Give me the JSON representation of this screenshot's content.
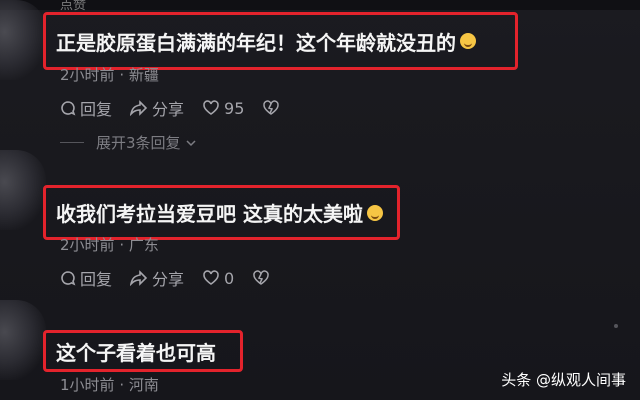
{
  "top_partial": "点赞",
  "comments": [
    {
      "text": "正是胶原蛋白满满的年纪！这个年龄就没丑的",
      "emoji": "laughing-tears-emoji",
      "time": "2小时前",
      "location": "新疆",
      "reply_label": "回复",
      "share_label": "分享",
      "likes": "95",
      "expand_label": "展开3条回复"
    },
    {
      "text": "收我们考拉当爱豆吧 这真的太美啦",
      "emoji": "smile-emoji",
      "time": "2小时前",
      "location": "广东",
      "reply_label": "回复",
      "share_label": "分享",
      "likes": "0"
    },
    {
      "text": "这个子看着也可高",
      "time": "1小时前",
      "location": "河南"
    }
  ],
  "watermark": "头条 @纵观人间事",
  "colors": {
    "highlight": "#e3232c",
    "background": "#1b1b20"
  }
}
